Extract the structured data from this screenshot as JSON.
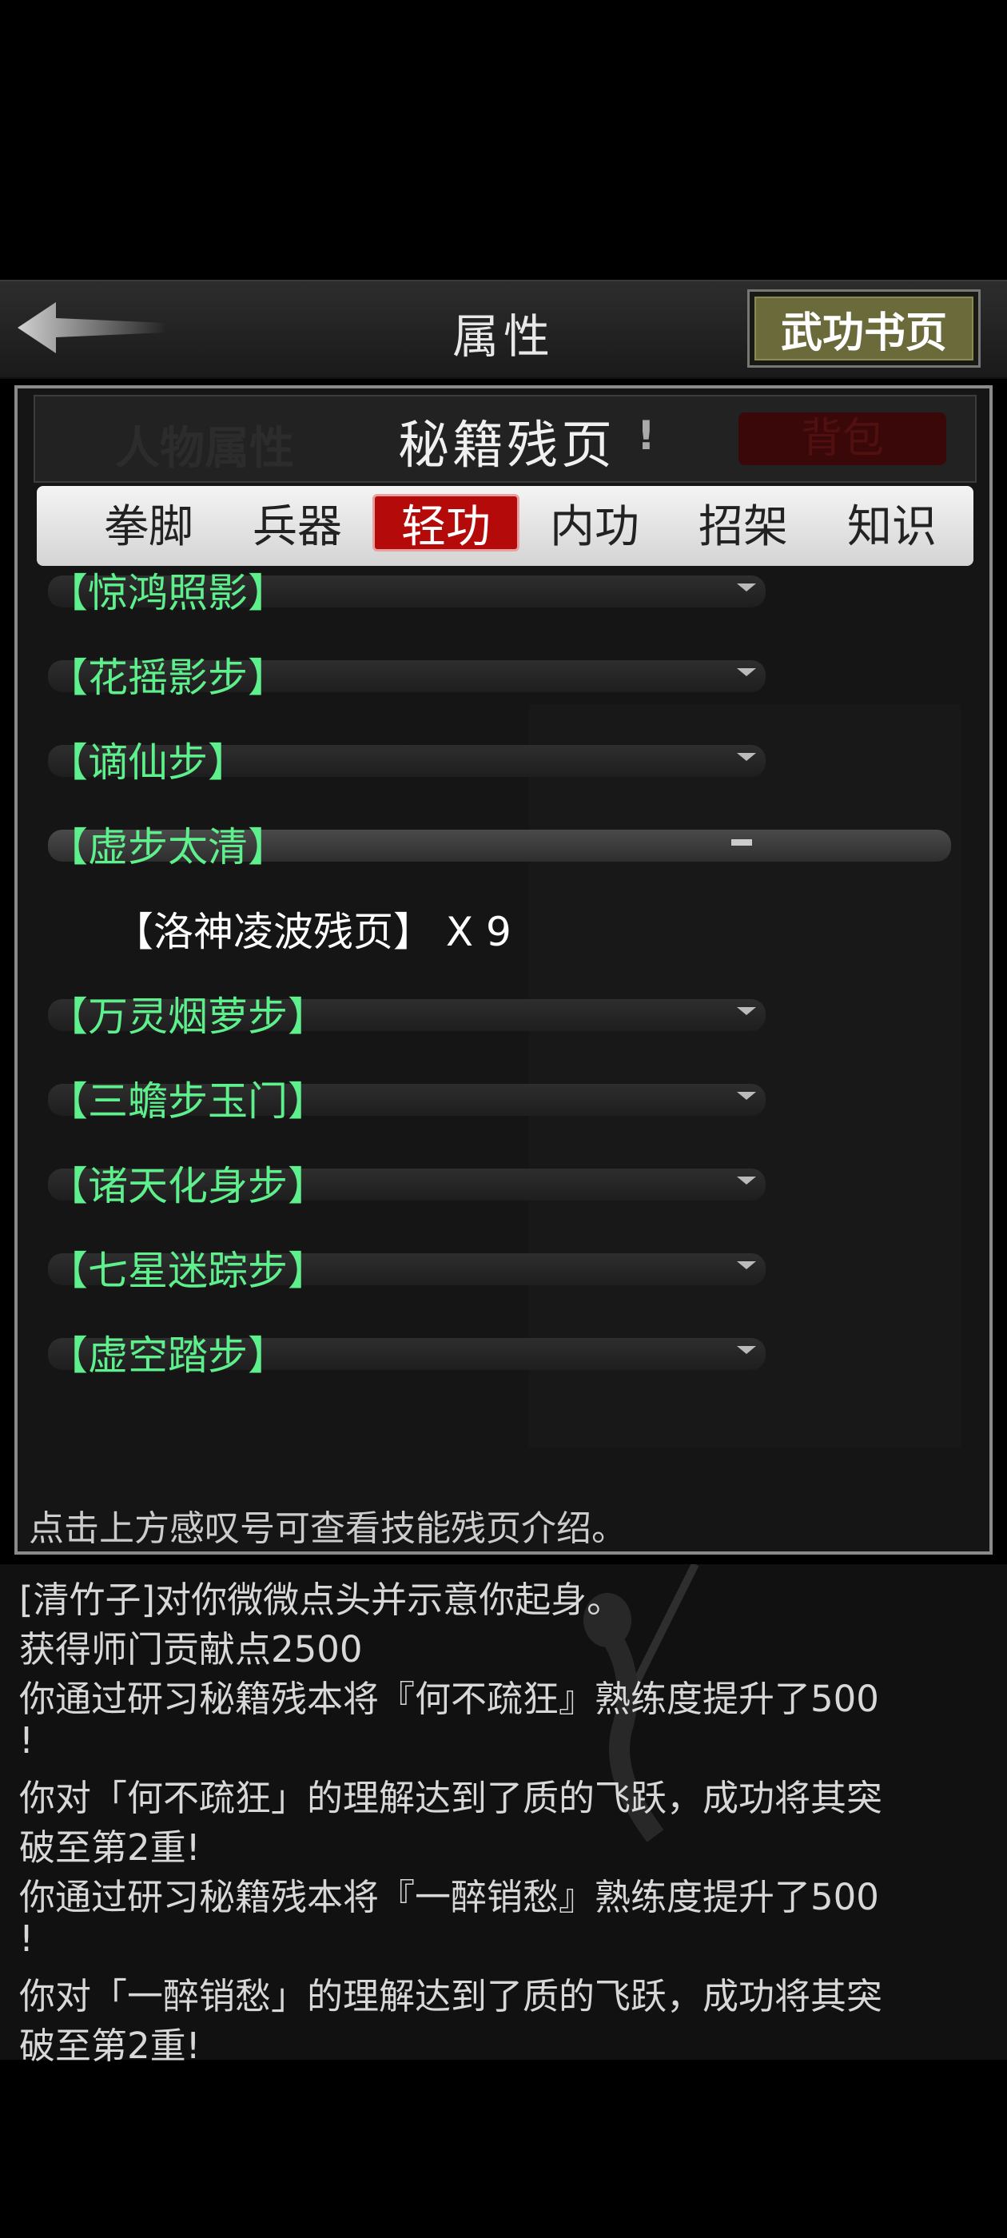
{
  "header": {
    "title": "属性",
    "right_button": "武功书页"
  },
  "panel": {
    "title": "秘籍残页",
    "info_mark": "!",
    "bg_tabs": [
      "人物属性",
      "背包"
    ],
    "tabs": [
      {
        "label": "拳脚",
        "active": false
      },
      {
        "label": "兵器",
        "active": false
      },
      {
        "label": "轻功",
        "active": true
      },
      {
        "label": "内功",
        "active": false
      },
      {
        "label": "招架",
        "active": false
      },
      {
        "label": "知识",
        "active": false
      }
    ],
    "items": [
      {
        "label": "【惊鸿照影】",
        "expanded": false
      },
      {
        "label": "【花摇影步】",
        "expanded": false
      },
      {
        "label": "【谪仙步】",
        "expanded": false
      },
      {
        "label": "【虚步太清】",
        "expanded": true
      },
      {
        "label": "【万灵烟萝步】",
        "expanded": false
      },
      {
        "label": "【三蟾步玉门】",
        "expanded": false
      },
      {
        "label": "【诸天化身步】",
        "expanded": false
      },
      {
        "label": "【七星迷踪步】",
        "expanded": false
      },
      {
        "label": "【虚空踏步】",
        "expanded": false
      }
    ],
    "expanded_entry": "【洛神凌波残页】  X 9",
    "footer_hint": "点击上方感叹号可查看技能残页介绍。"
  },
  "log": [
    "[清竹子]对你微微点头并示意你起身。",
    "获得师门贡献点2500",
    "你通过研习秘籍残本将『何不疏狂』熟练度提升了500",
    "!",
    "你对「何不疏狂」的理解达到了质的飞跃，成功将其突",
    "破至第2重!",
    "你通过研习秘籍残本将『一醉销愁』熟练度提升了500",
    "!",
    "你对「一醉销愁」的理解达到了质的飞跃，成功将其突",
    "破至第2重!"
  ],
  "colors": {
    "item_text": "#5df08c",
    "active_tab": "#b50a0a",
    "button_olive": "#6a6a3a"
  }
}
